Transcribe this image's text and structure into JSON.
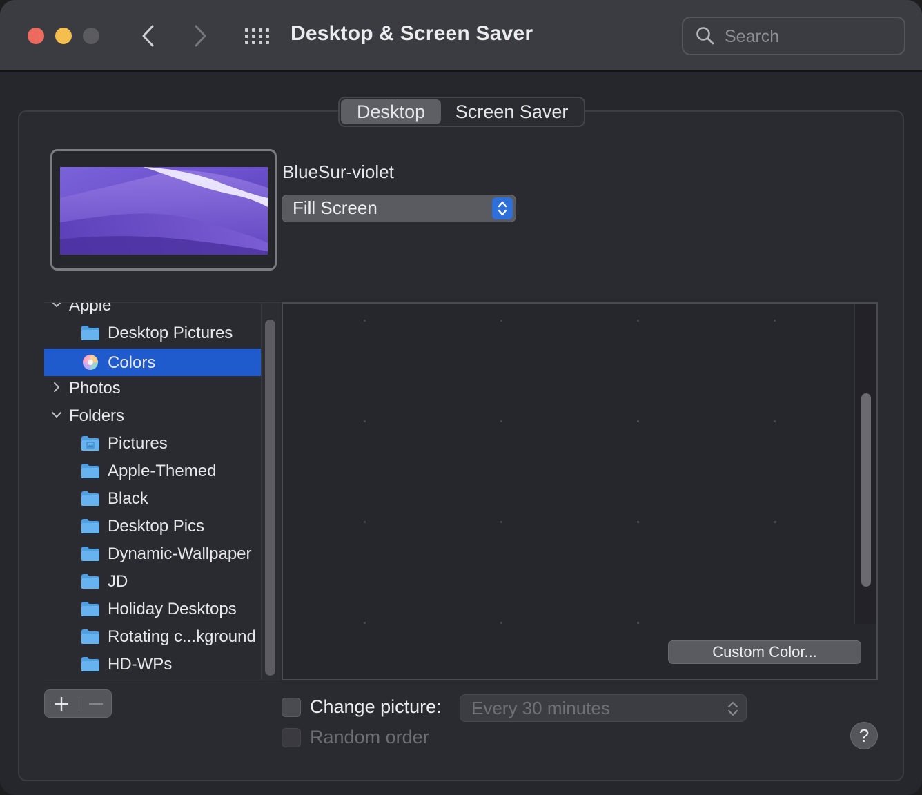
{
  "window": {
    "title": "Desktop & Screen Saver",
    "traffic_lights": {
      "close": "#ed6a5e",
      "minimize": "#f5bf4f",
      "zoom": "#5b5b60"
    }
  },
  "toolbar": {
    "back_icon": "chevron-left-icon",
    "forward_icon": "chevron-right-icon",
    "show_all_icon": "grid-icon"
  },
  "search": {
    "placeholder": "Search",
    "value": ""
  },
  "tabs": [
    {
      "label": "Desktop",
      "active": true
    },
    {
      "label": "Screen Saver",
      "active": false
    }
  ],
  "preview": {
    "wallpaper_name": "BlueSur-violet",
    "fit_option": "Fill Screen"
  },
  "sidebar": {
    "items": [
      {
        "label": "Apple",
        "level": 0,
        "disclosure": "expanded"
      },
      {
        "label": "Desktop Pictures",
        "level": 1,
        "icon": "folder-icon"
      },
      {
        "label": "Colors",
        "level": 1,
        "icon": "color-wheel-icon",
        "selected": true
      },
      {
        "label": "Photos",
        "level": 0,
        "disclosure": "collapsed"
      },
      {
        "label": "Folders",
        "level": 0,
        "disclosure": "expanded"
      },
      {
        "label": "Pictures",
        "level": 1,
        "icon": "pictures-folder-icon"
      },
      {
        "label": "Apple-Themed",
        "level": 1,
        "icon": "folder-icon"
      },
      {
        "label": "Black",
        "level": 1,
        "icon": "folder-icon"
      },
      {
        "label": "Desktop Pics",
        "level": 1,
        "icon": "folder-icon"
      },
      {
        "label": "Dynamic-Wallpaper",
        "level": 1,
        "icon": "folder-icon"
      },
      {
        "label": "JD",
        "level": 1,
        "icon": "folder-icon"
      },
      {
        "label": "Holiday Desktops",
        "level": 1,
        "icon": "folder-icon"
      },
      {
        "label": "Rotating c...kground",
        "level": 1,
        "icon": "folder-icon"
      },
      {
        "label": "HD-WPs",
        "level": 1,
        "icon": "folder-icon"
      }
    ]
  },
  "content": {
    "custom_color_label": "Custom Color..."
  },
  "bottom": {
    "add_label": "+",
    "remove_label": "−",
    "change_picture_label": "Change picture:",
    "change_picture_checked": false,
    "interval": "Every 30 minutes",
    "random_order_label": "Random order",
    "random_order_checked": false,
    "help_label": "?"
  },
  "colors": {
    "accent": "#1f5bcc",
    "stepper_blue": "#2f6fd9",
    "folder_blue": "#5aa7e6"
  }
}
